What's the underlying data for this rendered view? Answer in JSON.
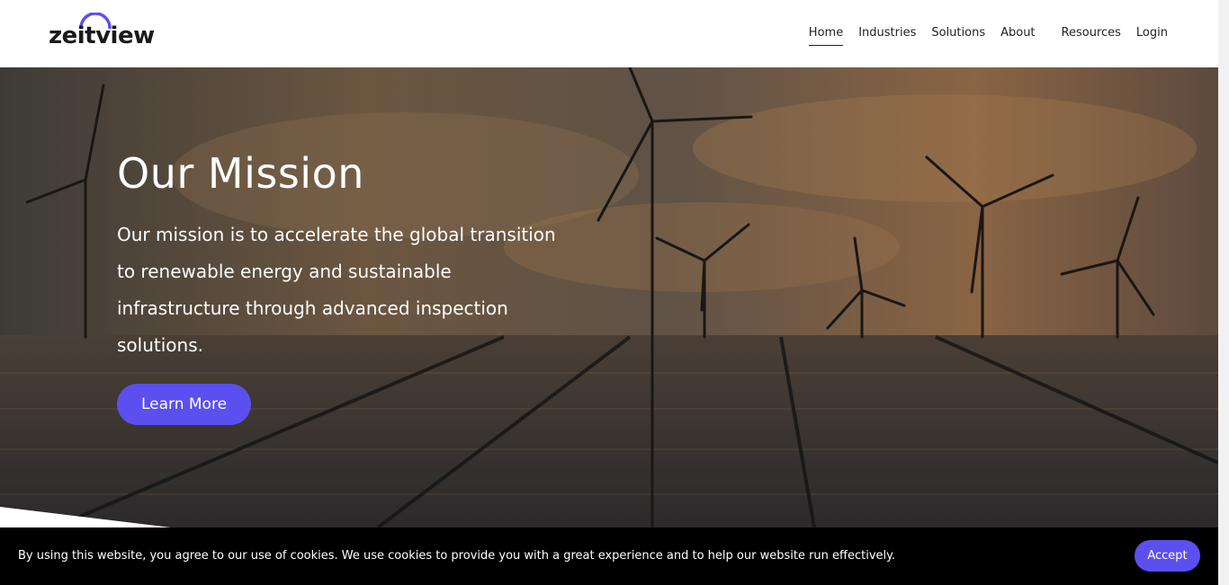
{
  "brand": {
    "logo_text": "zeitview",
    "accent_color": "#5b4ff0"
  },
  "nav": {
    "items": [
      {
        "label": "Home",
        "active": true
      },
      {
        "label": "Industries"
      },
      {
        "label": "Solutions"
      },
      {
        "label": "About"
      },
      {
        "label": "Resources"
      },
      {
        "label": "Login"
      }
    ]
  },
  "hero": {
    "title": "Our Mission",
    "text": "Our mission is to accelerate the global transition to renewable energy and sustainable infrastructure through advanced inspection solutions.",
    "cta_label": "Learn More",
    "background": "wind-turbines-solar-panels-sunset"
  },
  "cookie_banner": {
    "text": "By using this website, you agree to our use of cookies. We use cookies to provide you with a great experience and to help our website run effectively.",
    "accept_label": "Accept"
  }
}
